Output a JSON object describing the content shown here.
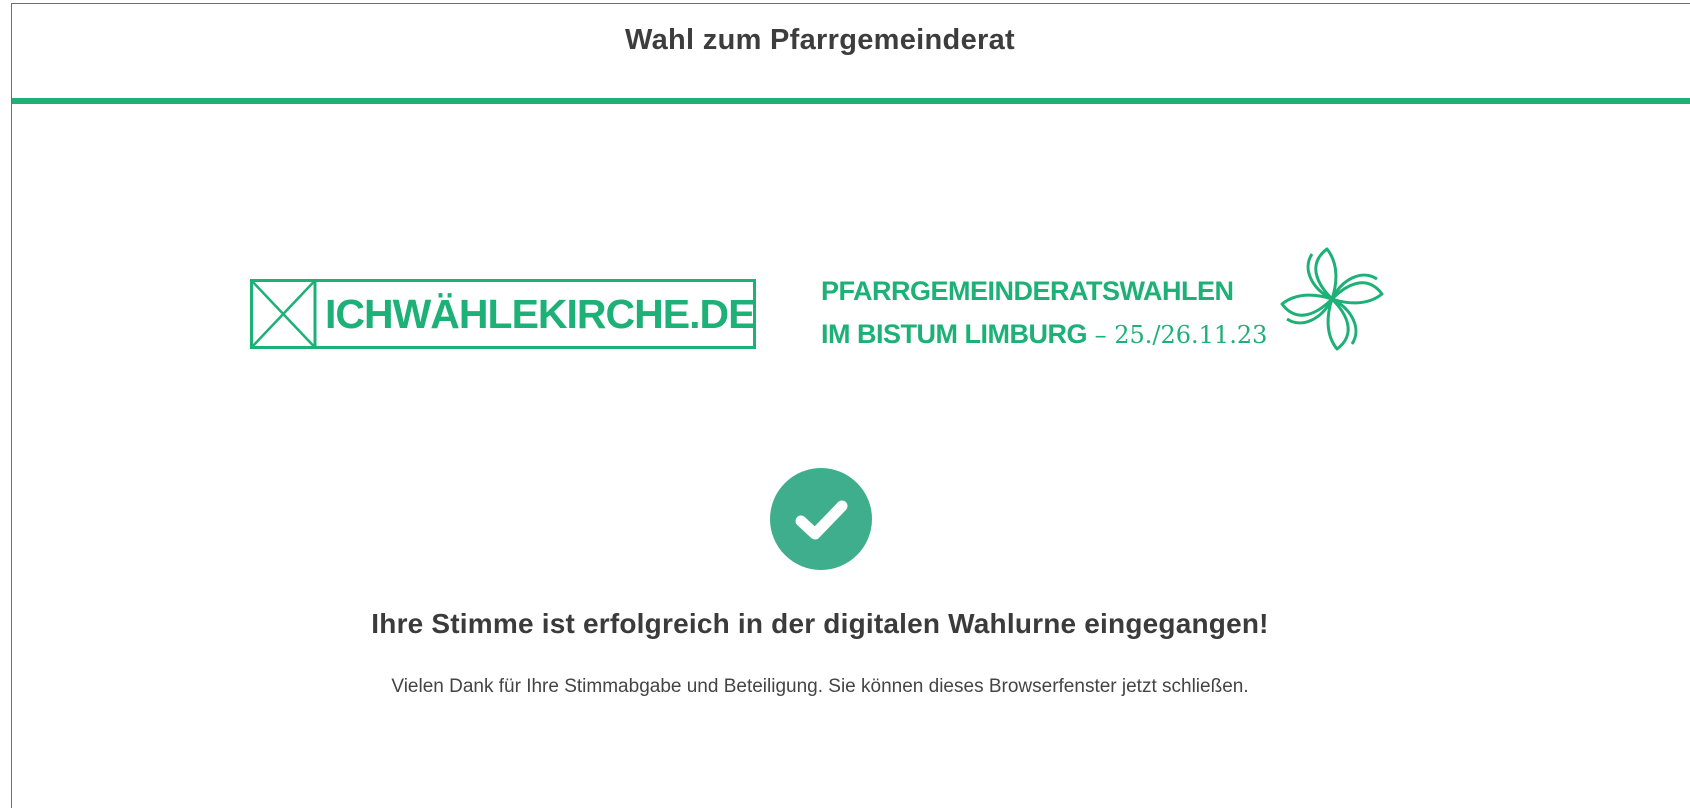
{
  "header": {
    "title": "Wahl zum Pfarrgemeinderat"
  },
  "logos": {
    "left_text": "ICHWÄHLEKIRCHE.DE",
    "right_line1": "PFARRGEMEINDERATSWAHLEN",
    "right_line2": "IM BISTUM LIMBURG",
    "right_date": " – 25./26.11.23"
  },
  "confirmation": {
    "icon": "checkmark-icon",
    "heading": "Ihre Stimme ist erfolgreich in der digitalen Wahlurne eingegangen!",
    "message": "Vielen Dank für Ihre Stimmabgabe und Beteiligung. Sie können dieses Browserfenster jetzt schließen."
  },
  "colors": {
    "brand_green": "#1db077",
    "check_circle": "#3fae8c"
  }
}
